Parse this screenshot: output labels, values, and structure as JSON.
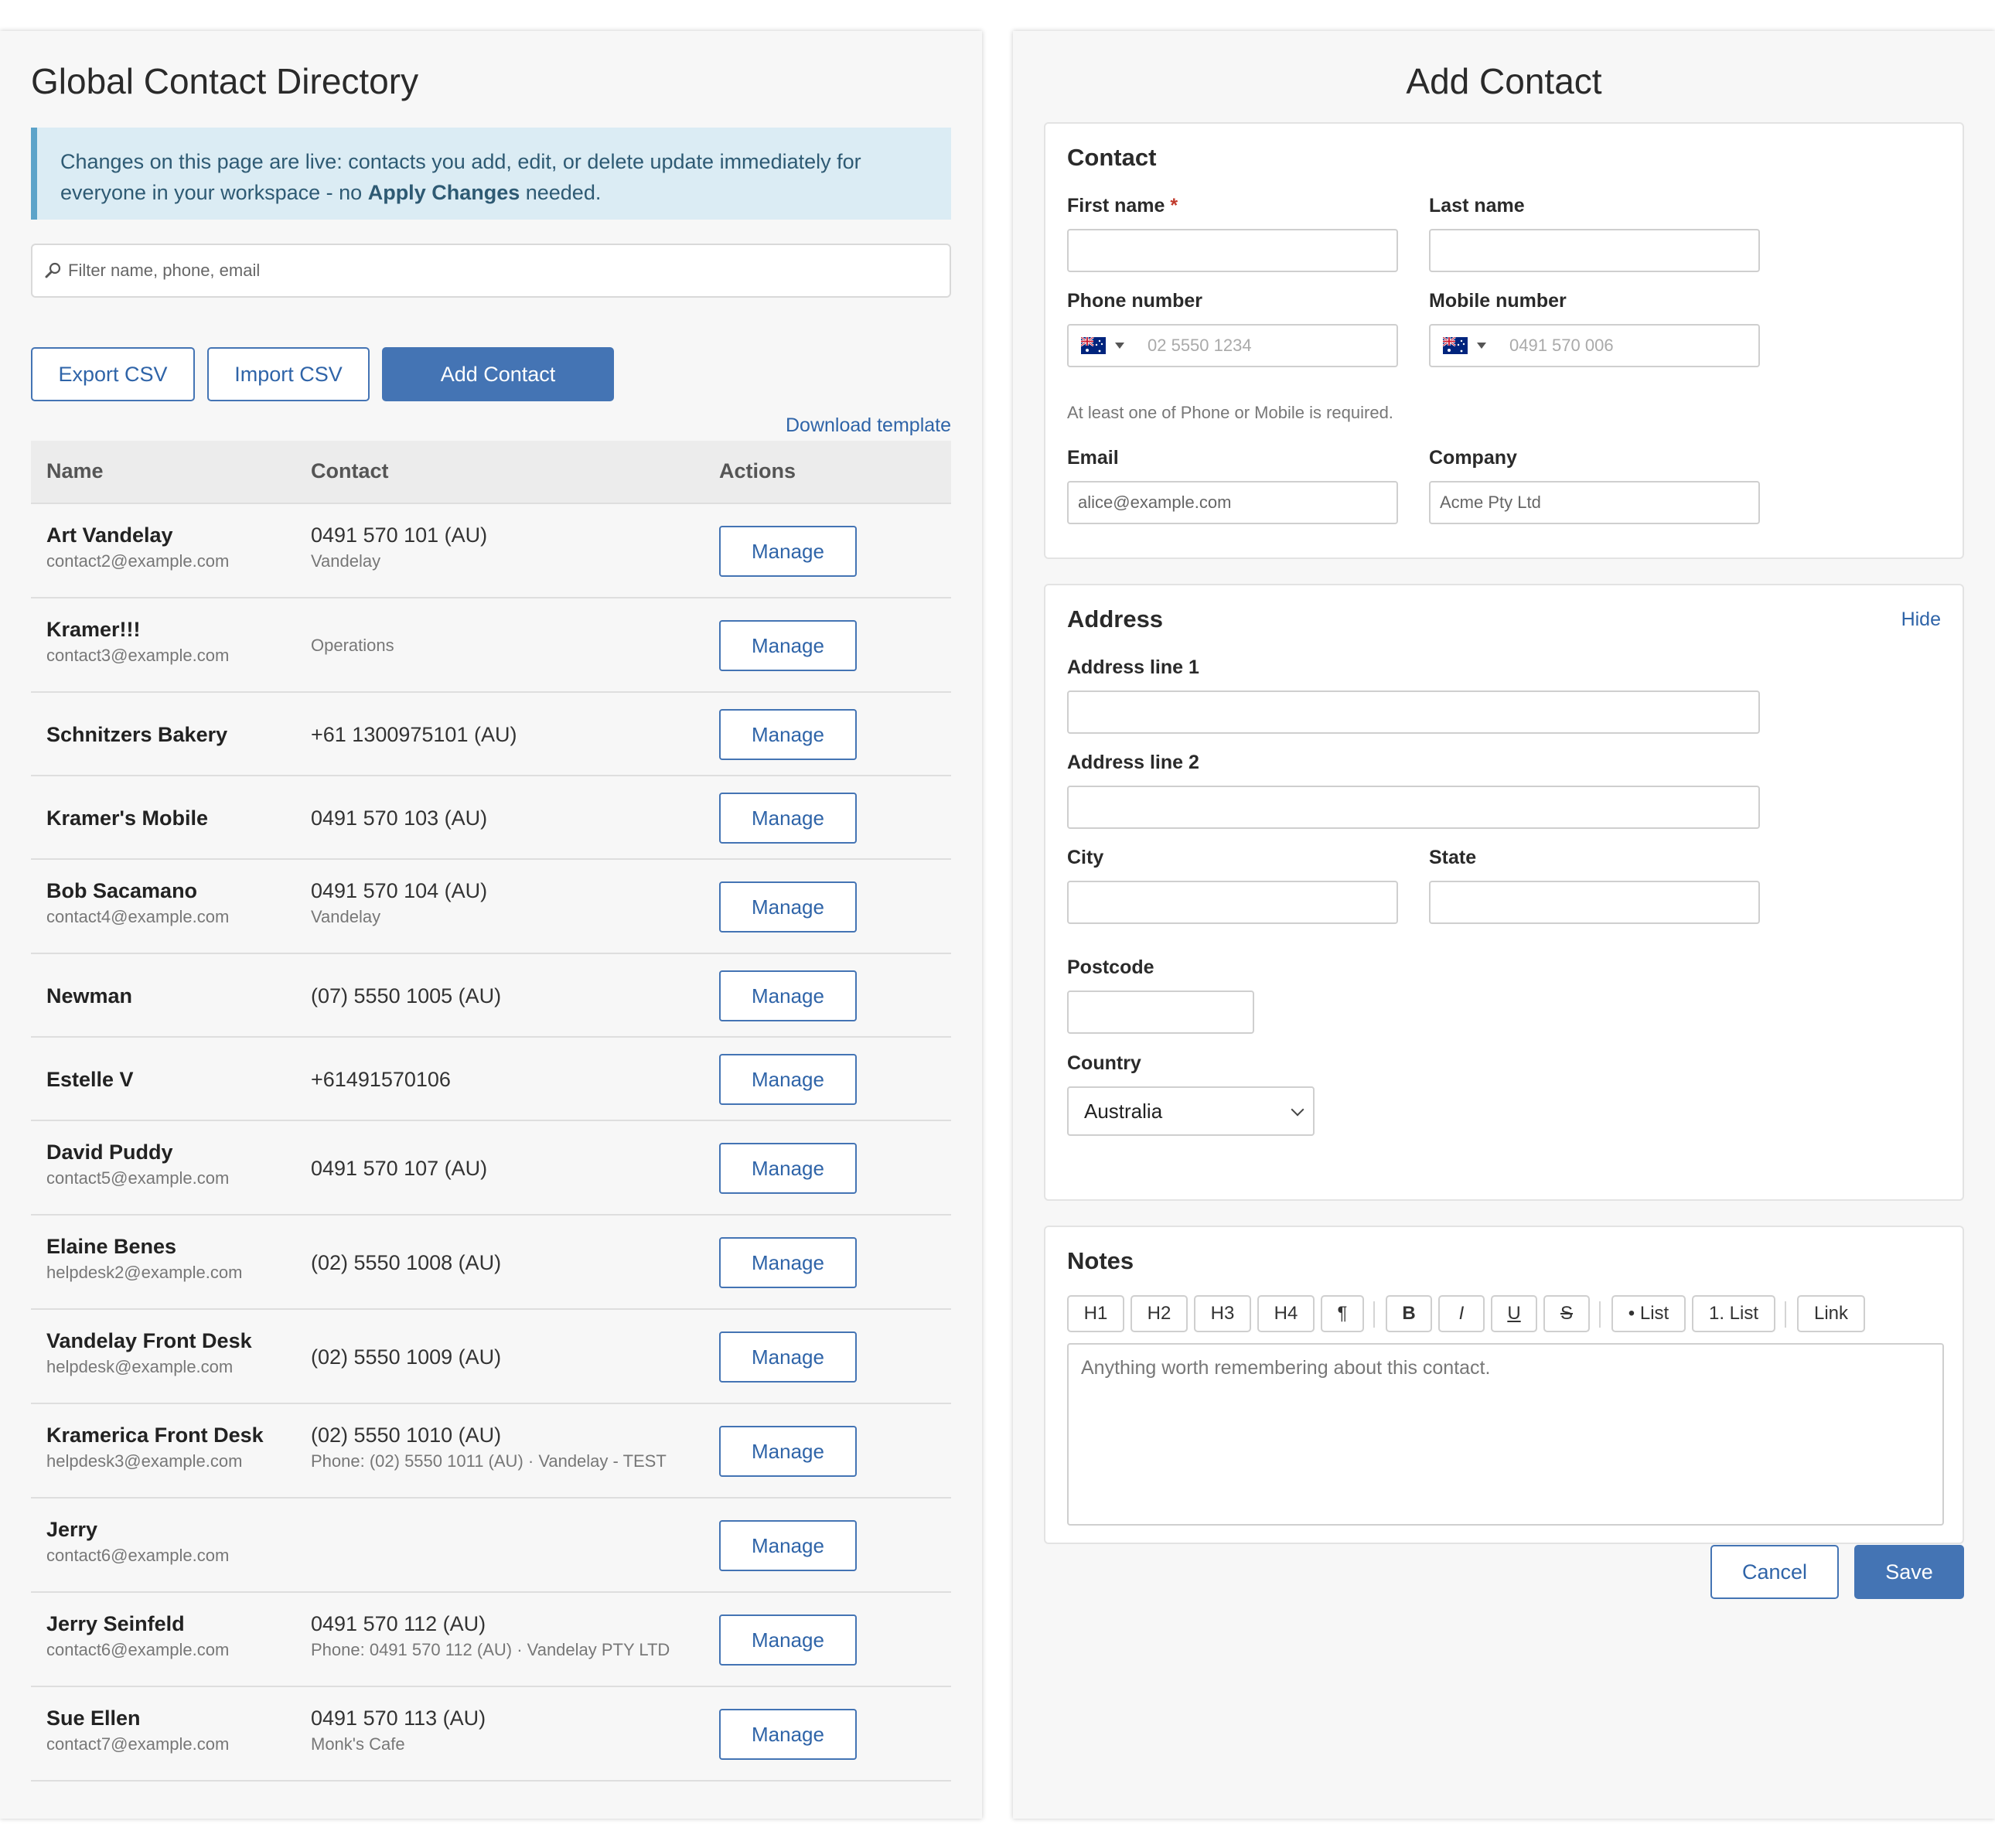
{
  "directory": {
    "title": "Global Contact Directory",
    "banner": {
      "text_before": "Changes on this page are live: contacts you add, edit, or delete update immediately for everyone in your workspace - no ",
      "bold": "Apply Changes",
      "text_after": " needed."
    },
    "search_placeholder": "Filter name, phone, email",
    "buttons": {
      "export": "Export CSV",
      "import": "Import CSV",
      "add": "Add Contact"
    },
    "download_template": "Download template",
    "columns": {
      "name": "Name",
      "contact": "Contact",
      "actions": "Actions"
    },
    "manage_label": "Manage",
    "rows": [
      {
        "name": "Art Vandelay",
        "email": "contact2@example.com",
        "contact": "0491 570 101 (AU)",
        "detail": "Vandelay"
      },
      {
        "name": "Kramer!!!",
        "email": "contact3@example.com",
        "contact": "",
        "detail": "Operations"
      },
      {
        "name": "Schnitzers Bakery",
        "email": "",
        "contact": "+61 1300975101 (AU)",
        "detail": ""
      },
      {
        "name": "Kramer's Mobile",
        "email": "",
        "contact": "0491 570 103 (AU)",
        "detail": ""
      },
      {
        "name": "Bob Sacamano",
        "email": "contact4@example.com",
        "contact": "0491 570 104 (AU)",
        "detail": "Vandelay"
      },
      {
        "name": "Newman",
        "email": "",
        "contact": "(07) 5550 1005 (AU)",
        "detail": ""
      },
      {
        "name": "Estelle V",
        "email": "",
        "contact": "+61491570106",
        "detail": ""
      },
      {
        "name": "David Puddy",
        "email": "contact5@example.com",
        "contact": "0491 570 107 (AU)",
        "detail": ""
      },
      {
        "name": "Elaine Benes",
        "email": "helpdesk2@example.com",
        "contact": "(02) 5550 1008 (AU)",
        "detail": ""
      },
      {
        "name": "Vandelay Front Desk",
        "email": "helpdesk@example.com",
        "contact": "(02) 5550 1009 (AU)",
        "detail": ""
      },
      {
        "name": "Kramerica Front Desk",
        "email": "helpdesk3@example.com",
        "contact": "(02) 5550 1010 (AU)",
        "detail": "Phone: (02) 5550 1011 (AU) · Vandelay - TEST"
      },
      {
        "name": "Jerry",
        "email": "contact6@example.com",
        "contact": "",
        "detail": ""
      },
      {
        "name": "Jerry Seinfeld",
        "email": "contact6@example.com",
        "contact": "0491 570 112 (AU)",
        "detail": "Phone: 0491 570 112 (AU) · Vandelay PTY LTD"
      },
      {
        "name": "Sue Ellen",
        "email": "contact7@example.com",
        "contact": "0491 570 113 (AU)",
        "detail": "Monk's Cafe"
      }
    ]
  },
  "form": {
    "title": "Add Contact",
    "contact": {
      "title": "Contact",
      "first_name_label": "First name",
      "required_mark": "*",
      "last_name_label": "Last name",
      "phone_label": "Phone number",
      "phone_placeholder": "02 5550 1234",
      "mobile_label": "Mobile number",
      "mobile_placeholder": "0491 570 006",
      "hint": "At least one of Phone or Mobile is required.",
      "email_label": "Email",
      "email_placeholder": "alice@example.com",
      "company_label": "Company",
      "company_placeholder": "Acme Pty Ltd",
      "flag_icon": "australia-flag-icon"
    },
    "address": {
      "title": "Address",
      "hide_label": "Hide",
      "line1_label": "Address line 1",
      "line2_label": "Address line 2",
      "city_label": "City",
      "state_label": "State",
      "postcode_label": "Postcode",
      "country_label": "Country",
      "country_value": "Australia"
    },
    "notes": {
      "title": "Notes",
      "toolbar": [
        "H1",
        "H2",
        "H3",
        "H4",
        "¶",
        "B",
        "I",
        "U",
        "S",
        "• List",
        "1. List",
        "Link"
      ],
      "placeholder": "Anything worth remembering about this contact."
    },
    "cancel_label": "Cancel",
    "save_label": "Save"
  },
  "colors": {
    "accent": "#4474b4",
    "banner_bg": "#dbecf4",
    "banner_border": "#5ca3c9",
    "required": "#c0392b"
  }
}
